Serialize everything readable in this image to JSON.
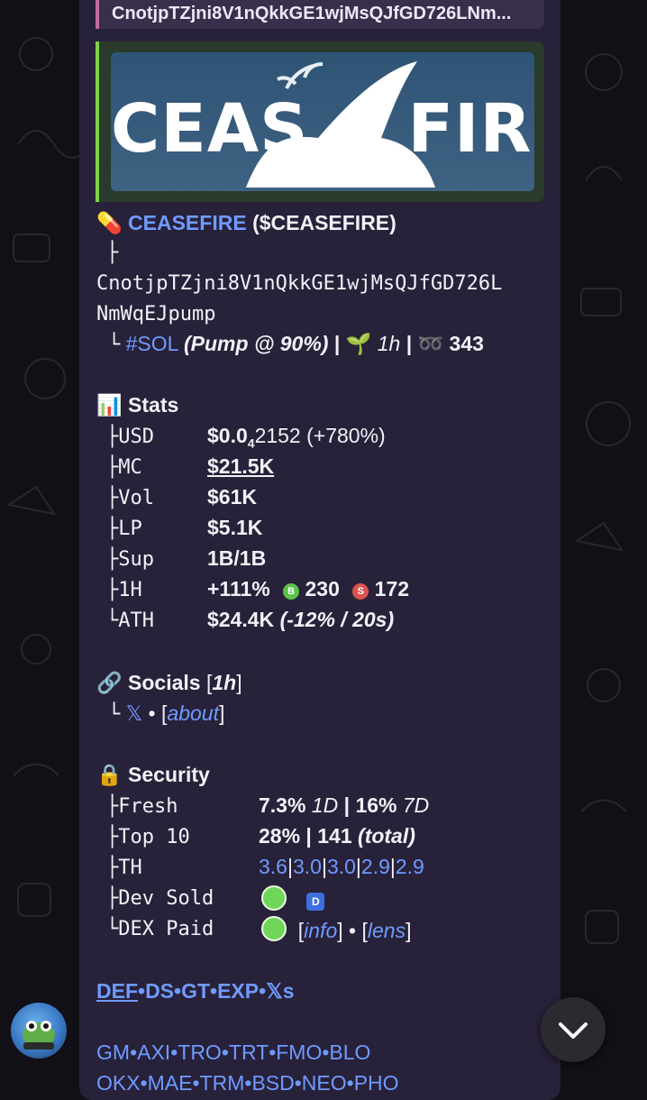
{
  "reply_preview": "CnotjpTZjni8V1nQkkGE1wjMsQJfGD726LNm...",
  "banner": {
    "left_text": "CEAS",
    "right_text": "FIRE"
  },
  "token": {
    "name": "CEASEFIRE",
    "ticker": "($CEASEFIRE)",
    "address_line1": "CnotjpTZjni8V1nQkkGE1wjMsQJfGD726L",
    "address_line2": "NmWqEJpump",
    "chain": "#SOL",
    "platform": "(Pump @ 90%)",
    "age": "1h",
    "holders": "343"
  },
  "stats": {
    "heading": "Stats",
    "usd_label": "USD",
    "usd_value": "$0.0",
    "usd_sub": "4",
    "usd_rest": "2152 (+780%)",
    "mc_label": "MC",
    "mc_value": "$21.5K",
    "vol_label": "Vol",
    "vol_value": "$61K",
    "lp_label": "LP",
    "lp_value": "$5.1K",
    "sup_label": "Sup",
    "sup_value": "1B/1B",
    "h1_label": "1H",
    "h1_value": "+111%",
    "buys": "230",
    "sells": "172",
    "buy_badge": "B",
    "sell_badge": "S",
    "ath_label": "ATH",
    "ath_value": "$24.4K",
    "ath_note": "(-12% / 20s)"
  },
  "socials": {
    "heading": "Socials",
    "age": "1h",
    "x_label": "𝕏",
    "about": "about"
  },
  "security": {
    "heading": "Security",
    "fresh_label": "Fresh",
    "fresh_1d": "7.3%",
    "fresh_1d_unit": "1D",
    "fresh_7d": "16%",
    "fresh_7d_unit": "7D",
    "top10_label": "Top 10",
    "top10_value": "28%",
    "top10_total": "141",
    "top10_total_note": "(total)",
    "th_label": "TH",
    "th_values": [
      "3.6",
      "3.0",
      "3.0",
      "2.9",
      "2.9"
    ],
    "devsold_label": "Dev Sold",
    "dev_badge": "D",
    "dexpaid_label": "DEX Paid",
    "info": "info",
    "lens": "lens"
  },
  "links_row1": [
    "DEF",
    "DS",
    "GT",
    "EXP",
    "𝕏s"
  ],
  "links_row2": [
    "GM",
    "AXI",
    "TRO",
    "TRT",
    "FMO",
    "BLO"
  ],
  "links_row3": [
    "OKX",
    "MAE",
    "TRM",
    "BSD",
    "NEO",
    "PHO"
  ],
  "colors": {
    "bubble": "#28213a",
    "link": "#6f9bff",
    "reply_bar": "#c46aa3",
    "preview_bar": "#7fd24a"
  }
}
